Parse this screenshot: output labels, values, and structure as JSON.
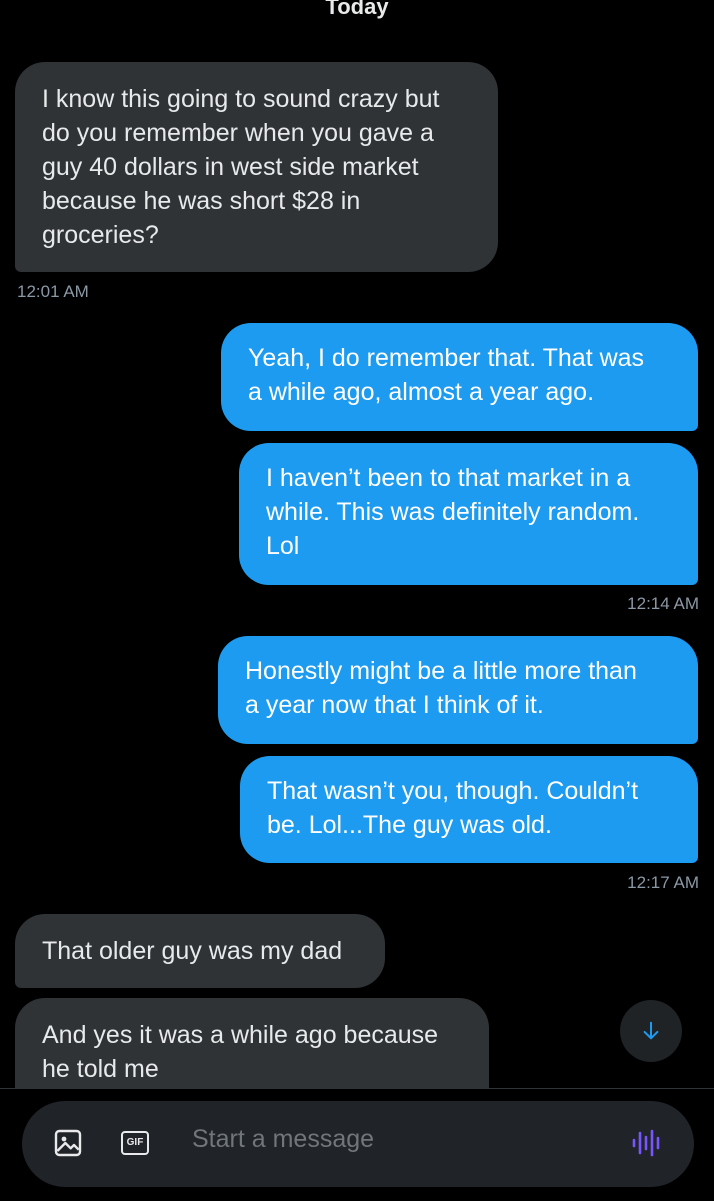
{
  "thread": {
    "date_label": "Today",
    "messages": [
      {
        "direction": "incoming",
        "text": "I know this going to sound crazy but\ndo you remember when you gave a\nguy 40 dollars in west side market\nbecause he was short $28 in\ngroceries?"
      },
      {
        "direction": "outgoing",
        "text": "Yeah, I do remember that. That was\na while ago, almost a year ago."
      },
      {
        "direction": "outgoing",
        "text": "I haven’t been to that market in a\nwhile. This was definitely random.\nLol"
      },
      {
        "direction": "outgoing",
        "text": "Honestly might be a little more than\na year now that I think of it."
      },
      {
        "direction": "outgoing",
        "text": "That wasn’t you, though. Couldn’t\nbe. Lol...The guy was old."
      },
      {
        "direction": "incoming",
        "text": "That older guy was my dad"
      },
      {
        "direction": "incoming",
        "text": "And yes it was a while ago because\nhe told me"
      }
    ],
    "timestamps": [
      "12:01 AM",
      "12:14 AM",
      "12:17 AM"
    ]
  },
  "scroll_button": {
    "icon": "arrow-down-icon"
  },
  "composer": {
    "placeholder": "Start a message",
    "gif_label": "GIF",
    "media_icon": "image-icon",
    "voice_icon": "voice-waveform-icon"
  },
  "colors": {
    "background": "#000000",
    "incoming_bubble": "#2f3336",
    "outgoing_bubble": "#1d9bf0",
    "timestamp": "#8b98a5",
    "accent": "#1d9bf0",
    "voice_accent": "#7856ff"
  }
}
